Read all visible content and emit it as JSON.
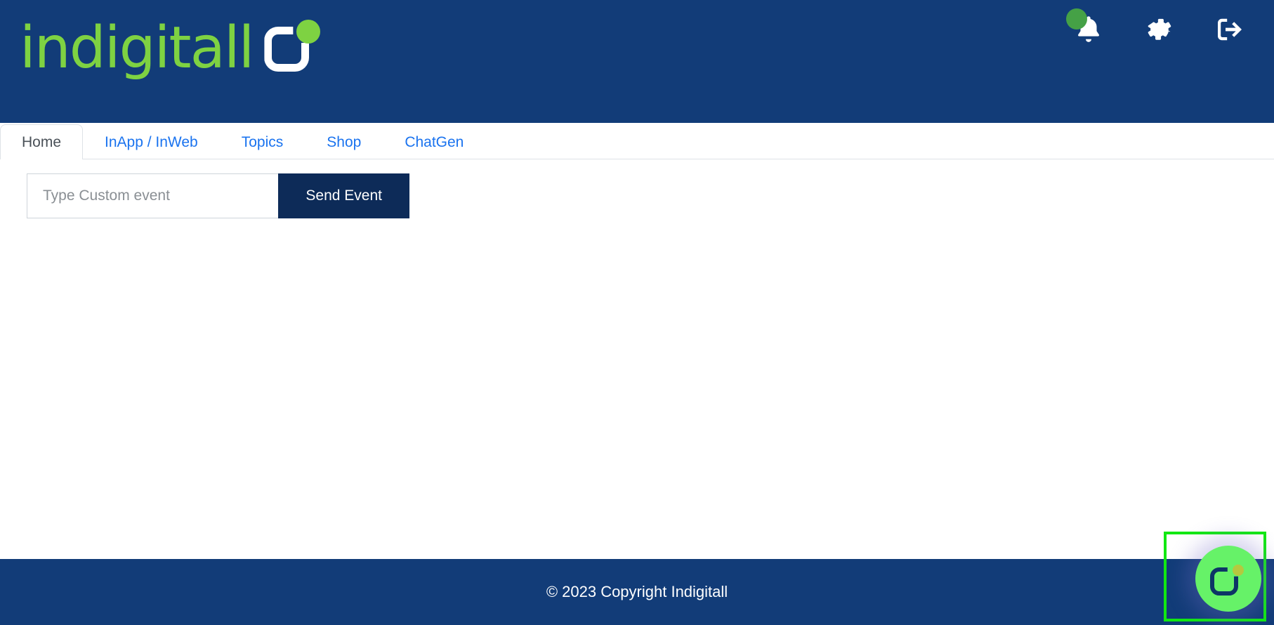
{
  "header": {
    "brand_word": "indigitall",
    "brand_mark_name": "indigitall-logo-mark",
    "colors": {
      "navy": "#123c78",
      "green": "#7ed242",
      "badge_green": "#45a146",
      "link_blue": "#1a73ef",
      "button_navy": "#0d2b58"
    },
    "icons": [
      {
        "name": "notifications-bell-icon",
        "label": "Notifications",
        "badge": true
      },
      {
        "name": "gear-icon",
        "label": "Settings",
        "badge": false
      },
      {
        "name": "logout-icon",
        "label": "Log out",
        "badge": false
      }
    ]
  },
  "tabs": [
    {
      "label": "Home",
      "active": true
    },
    {
      "label": "InApp / InWeb",
      "active": false
    },
    {
      "label": "Topics",
      "active": false
    },
    {
      "label": "Shop",
      "active": false
    },
    {
      "label": "ChatGen",
      "active": false
    }
  ],
  "main": {
    "event_input": {
      "placeholder": "Type Custom event",
      "value": ""
    },
    "send_button_label": "Send Event"
  },
  "footer": {
    "copyright": "© 2023 Copyright Indigitall"
  },
  "chat_widget": {
    "name": "chatgen-launcher",
    "highlighted": true,
    "highlight_color": "#12e812",
    "fab_color": "#66f268"
  }
}
